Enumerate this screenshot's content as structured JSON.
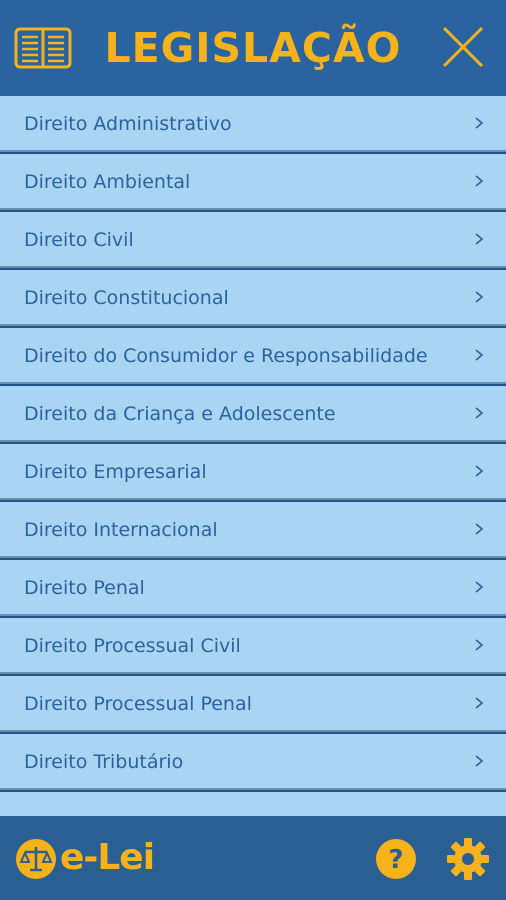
{
  "header": {
    "title": "LEGISLAÇÃO",
    "menu_icon": "book-icon",
    "close_icon": "close-icon"
  },
  "list": {
    "items": [
      {
        "label": "Direito Administrativo"
      },
      {
        "label": "Direito Ambiental"
      },
      {
        "label": "Direito Civil"
      },
      {
        "label": "Direito Constitucional"
      },
      {
        "label": "Direito do Consumidor e Responsabilidade"
      },
      {
        "label": "Direito da Criança e Adolescente"
      },
      {
        "label": "Direito Empresarial"
      },
      {
        "label": "Direito Internacional"
      },
      {
        "label": "Direito Penal"
      },
      {
        "label": "Direito Processual Civil"
      },
      {
        "label": "Direito Processual Penal"
      },
      {
        "label": "Direito Tributário"
      }
    ]
  },
  "footer": {
    "logo_text": "e-Lei",
    "help_icon": "help-icon",
    "settings_icon": "gear-icon"
  },
  "colors": {
    "accent": "#f5b21a",
    "header": "#2a64a0",
    "row_bg": "#a9d4f2",
    "row_text": "#2b63a0"
  }
}
